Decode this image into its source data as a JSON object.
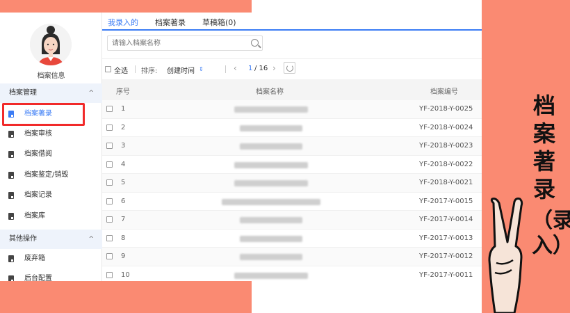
{
  "sidebar": {
    "profile_label": "档案信息",
    "groups": [
      {
        "title": "档案管理",
        "items": [
          {
            "label": "档案著录",
            "active": true
          },
          {
            "label": "档案审核"
          },
          {
            "label": "档案借阅"
          },
          {
            "label": "档案鉴定/销毁"
          },
          {
            "label": "档案记录"
          },
          {
            "label": "档案库"
          }
        ]
      },
      {
        "title": "其他操作",
        "items": [
          {
            "label": "废弃箱"
          },
          {
            "label": "后台配置"
          }
        ]
      }
    ]
  },
  "tabs": [
    {
      "label": "我录入的",
      "active": true
    },
    {
      "label": "档案著录"
    },
    {
      "label": "草稿箱(0)"
    }
  ],
  "search": {
    "placeholder": "请输入档案名称"
  },
  "toolbar": {
    "select_all": "全选",
    "sort_label": "排序:",
    "sort_value": "创建时间",
    "page_current": "1",
    "page_total": "/ 16"
  },
  "table": {
    "headers": [
      "序号",
      "档案名称",
      "档案编号"
    ],
    "rows": [
      {
        "idx": "1",
        "code": "YF-2018-Y-0025"
      },
      {
        "idx": "2",
        "code": "YF-2018-Y-0024"
      },
      {
        "idx": "3",
        "code": "YF-2018-Y-0023"
      },
      {
        "idx": "4",
        "code": "YF-2018-Y-0022"
      },
      {
        "idx": "5",
        "code": "YF-2018-Y-0021"
      },
      {
        "idx": "6",
        "code": "YF-2017-Y-0015"
      },
      {
        "idx": "7",
        "code": "YF-2017-Y-0014"
      },
      {
        "idx": "8",
        "code": "YF-2017-Y-0013"
      },
      {
        "idx": "9",
        "code": "YF-2017-Y-0012"
      },
      {
        "idx": "10",
        "code": "YF-2017-Y-0011"
      }
    ]
  },
  "overlay": {
    "title": "档案著录",
    "subtitle": "（录入）"
  },
  "colors": {
    "accent": "#3b7cf5",
    "frame": "#FA8A72",
    "highlight": "#f12a2a"
  }
}
